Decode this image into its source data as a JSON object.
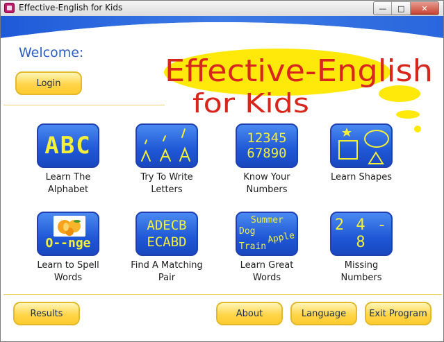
{
  "window": {
    "title": "Effective-English for Kids",
    "controls": {
      "minimize": "—",
      "maximize": "□",
      "close": "✕"
    }
  },
  "header": {
    "welcome": "Welcome:",
    "login_label": "Login",
    "logo_line1": "Effective-English",
    "logo_line2": "for Kids"
  },
  "tiles": [
    {
      "label": "Learn The\nAlphabet",
      "art": "ABC"
    },
    {
      "label": "Try To Write\nLetters",
      "art": "/ / /  A A A"
    },
    {
      "label": "Know Your\nNumbers",
      "art_line1": "12345",
      "art_line2": "67890"
    },
    {
      "label": "Learn Shapes",
      "art": "shapes"
    },
    {
      "label": "Learn to Spell\nWords",
      "art": "O--nge"
    },
    {
      "label": "Find A Matching\nPair",
      "art_line1": "ADECB",
      "art_line2": "ECABD"
    },
    {
      "label": "Learn Great\nWords",
      "art_words": [
        "Summer",
        "Dog",
        "Apple",
        "Train"
      ]
    },
    {
      "label": "Missing\nNumbers",
      "art": "2 4 - 8"
    }
  ],
  "footer": {
    "results": "Results",
    "about": "About",
    "language": "Language",
    "exit": "Exit Program"
  },
  "colors": {
    "accent_blue": "#2b5fc8",
    "button_yellow": "#ffd54a",
    "tile_blue": "#1f57d6",
    "logo_red": "#d9261c"
  }
}
